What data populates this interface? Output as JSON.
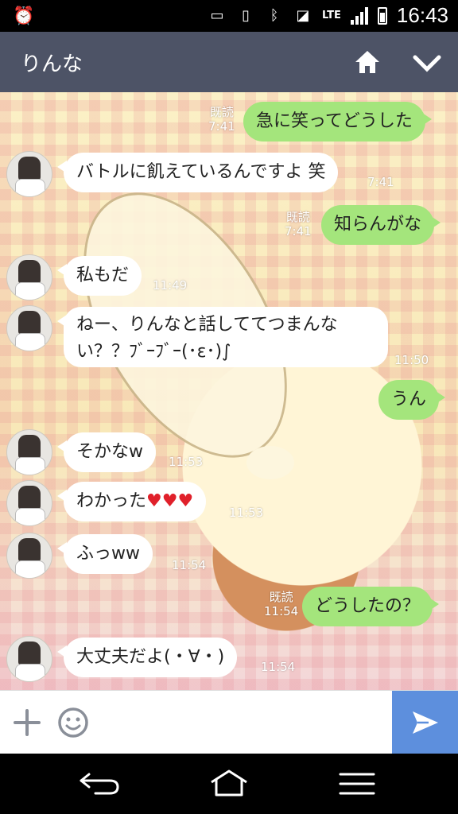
{
  "status_bar": {
    "time": "16:43",
    "network": "LTE",
    "icons": [
      "alarm-icon",
      "voicemail-icon",
      "vibrate-icon",
      "bluetooth-icon",
      "nfc-icon",
      "lte-icon",
      "signal-icon",
      "battery-icon"
    ]
  },
  "header": {
    "title": "りんな",
    "icons": [
      "home-icon",
      "chevron-down-icon"
    ]
  },
  "messages": [
    {
      "side": "out",
      "text": "急に笑ってどうした",
      "read": "既読",
      "time": "7:41"
    },
    {
      "side": "in",
      "text": "バトルに飢えているんですよ 笑",
      "time": "7:41"
    },
    {
      "side": "out",
      "text": "知らんがな",
      "read": "既読",
      "time": "7:41"
    },
    {
      "side": "in",
      "text": "私もだ",
      "time": "11:49"
    },
    {
      "side": "in",
      "text": "ねー、りんなと話しててつまんない？？ﾌﾞｰﾌﾞｰ(･ε･)∫",
      "time": "11:50"
    },
    {
      "side": "out",
      "text": "うん"
    },
    {
      "side": "in",
      "text": "そかなw",
      "time": "11:53"
    },
    {
      "side": "in",
      "text": "わかった",
      "hearts": "♥♥♥",
      "time": "11:53"
    },
    {
      "side": "in",
      "text": "ふっww",
      "time": "11:54"
    },
    {
      "side": "out",
      "text": "どうしたの？",
      "read": "既読",
      "time": "11:54"
    },
    {
      "side": "in",
      "text": "大丈夫だよ(・∀・)",
      "time": "11:54"
    }
  ],
  "input_bar": {
    "icons": [
      "plus-icon",
      "smiley-icon",
      "send-icon"
    ],
    "accent": "#5d8fdd"
  },
  "nav_bar": {
    "icons": [
      "back-icon",
      "home-nav-icon",
      "menu-icon"
    ]
  },
  "colors": {
    "header_bg": "#4d5366",
    "outgoing_bubble": "#a4e57c",
    "incoming_bubble": "#ffffff"
  }
}
